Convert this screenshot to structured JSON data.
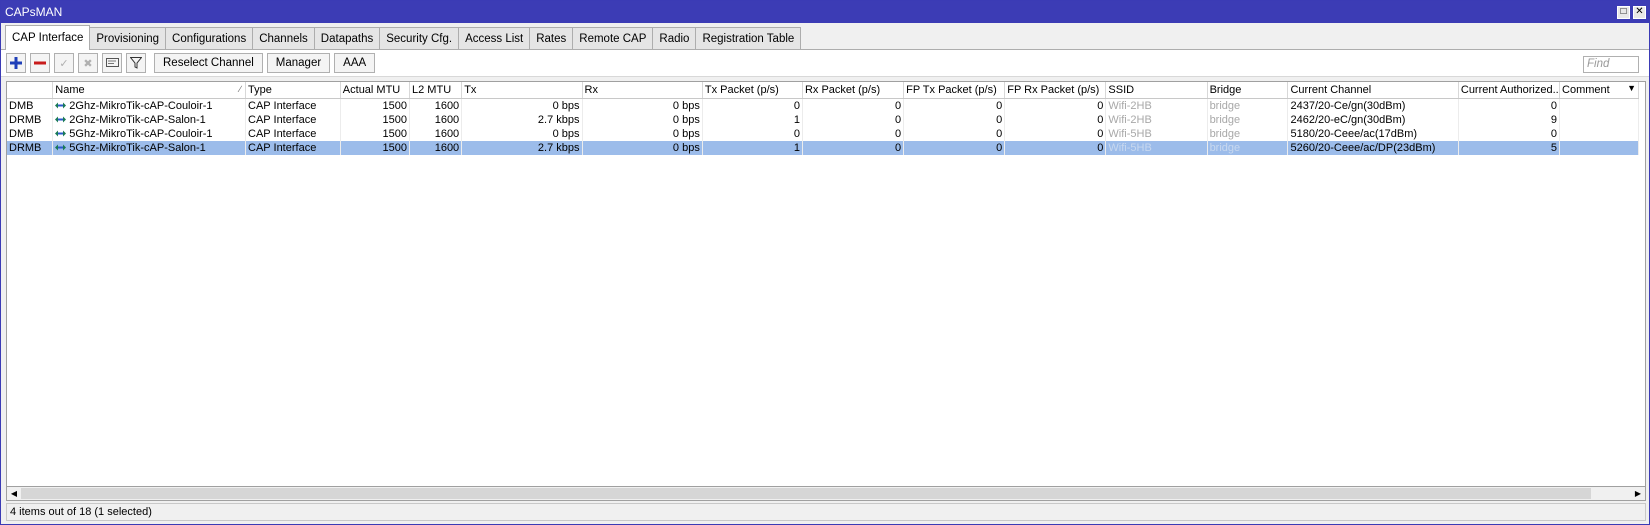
{
  "window": {
    "title": "CAPsMAN"
  },
  "tabs": [
    "CAP Interface",
    "Provisioning",
    "Configurations",
    "Channels",
    "Datapaths",
    "Security Cfg.",
    "Access List",
    "Rates",
    "Remote CAP",
    "Radio",
    "Registration Table"
  ],
  "toolbar": {
    "reselect_label": "Reselect Channel",
    "manager_label": "Manager",
    "aaa_label": "AAA",
    "find_placeholder": "Find"
  },
  "table": {
    "columns": [
      "",
      "Name",
      "Type",
      "Actual MTU",
      "L2 MTU",
      "Tx",
      "Rx",
      "Tx Packet (p/s)",
      "Rx Packet (p/s)",
      "FP Tx Packet (p/s)",
      "FP Rx Packet (p/s)",
      "SSID",
      "Bridge",
      "Current Channel",
      "Current Authorized...",
      "Comment"
    ],
    "rows": [
      {
        "flags": "DMB",
        "name": "2Ghz-MikroTik-cAP-Couloir-1",
        "type": "CAP Interface",
        "actual_mtu": "1500",
        "l2_mtu": "1600",
        "tx": "0 bps",
        "rx": "0 bps",
        "tx_packet": "0",
        "rx_packet": "0",
        "fp_tx": "0",
        "fp_rx": "0",
        "ssid": "Wifi-2HB",
        "bridge": "bridge",
        "channel": "2437/20-Ce/gn(30dBm)",
        "authorized": "0",
        "comment": ""
      },
      {
        "flags": "DRMB",
        "name": "2Ghz-MikroTik-cAP-Salon-1",
        "type": "CAP Interface",
        "actual_mtu": "1500",
        "l2_mtu": "1600",
        "tx": "2.7 kbps",
        "rx": "0 bps",
        "tx_packet": "1",
        "rx_packet": "0",
        "fp_tx": "0",
        "fp_rx": "0",
        "ssid": "Wifi-2HB",
        "bridge": "bridge",
        "channel": "2462/20-eC/gn(30dBm)",
        "authorized": "9",
        "comment": ""
      },
      {
        "flags": "DMB",
        "name": "5Ghz-MikroTik-cAP-Couloir-1",
        "type": "CAP Interface",
        "actual_mtu": "1500",
        "l2_mtu": "1600",
        "tx": "0 bps",
        "rx": "0 bps",
        "tx_packet": "0",
        "rx_packet": "0",
        "fp_tx": "0",
        "fp_rx": "0",
        "ssid": "Wifi-5HB",
        "bridge": "bridge",
        "channel": "5180/20-Ceee/ac(17dBm)",
        "authorized": "0",
        "comment": ""
      },
      {
        "flags": "DRMB",
        "name": "5Ghz-MikroTik-cAP-Salon-1",
        "type": "CAP Interface",
        "actual_mtu": "1500",
        "l2_mtu": "1600",
        "tx": "2.7 kbps",
        "rx": "0 bps",
        "tx_packet": "1",
        "rx_packet": "0",
        "fp_tx": "0",
        "fp_rx": "0",
        "ssid": "Wifi-5HB",
        "bridge": "bridge",
        "channel": "5260/20-Ceee/ac/DP(23dBm)",
        "authorized": "5",
        "comment": "",
        "selected": true
      }
    ]
  },
  "status": {
    "text": "4 items out of 18 (1 selected)"
  },
  "colors": {
    "titlebar": "#3c3cb5",
    "selection": "#9cbcea"
  }
}
